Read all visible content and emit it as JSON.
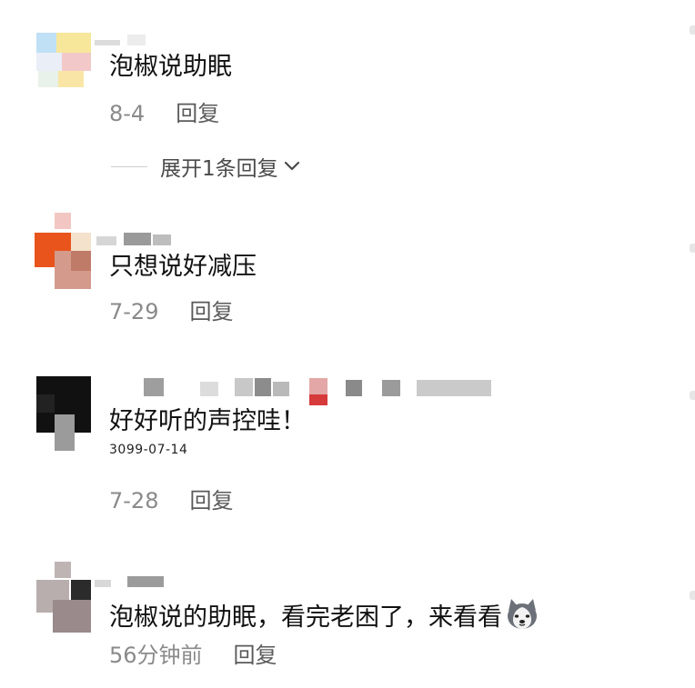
{
  "comments": [
    {
      "text": "泡椒说助眠",
      "date": "8-4",
      "reply_label": "回复",
      "expand_label": "展开1条回复"
    },
    {
      "text": "只想说好减压",
      "date": "7-29",
      "reply_label": "回复"
    },
    {
      "text": "好好听的声控哇！",
      "badge_date": "3099-07-14",
      "date": "7-28",
      "reply_label": "回复"
    },
    {
      "text": "泡椒说的助眠，看完老困了，来看看",
      "emoji": "husky-dog-emoji",
      "date": "56分钟前",
      "reply_label": "回复"
    }
  ],
  "icons": {
    "expand": "chevron-down-icon"
  },
  "colors": {
    "text": "#111111",
    "meta": "#8a8a8a",
    "reply": "#5a5a5a"
  }
}
